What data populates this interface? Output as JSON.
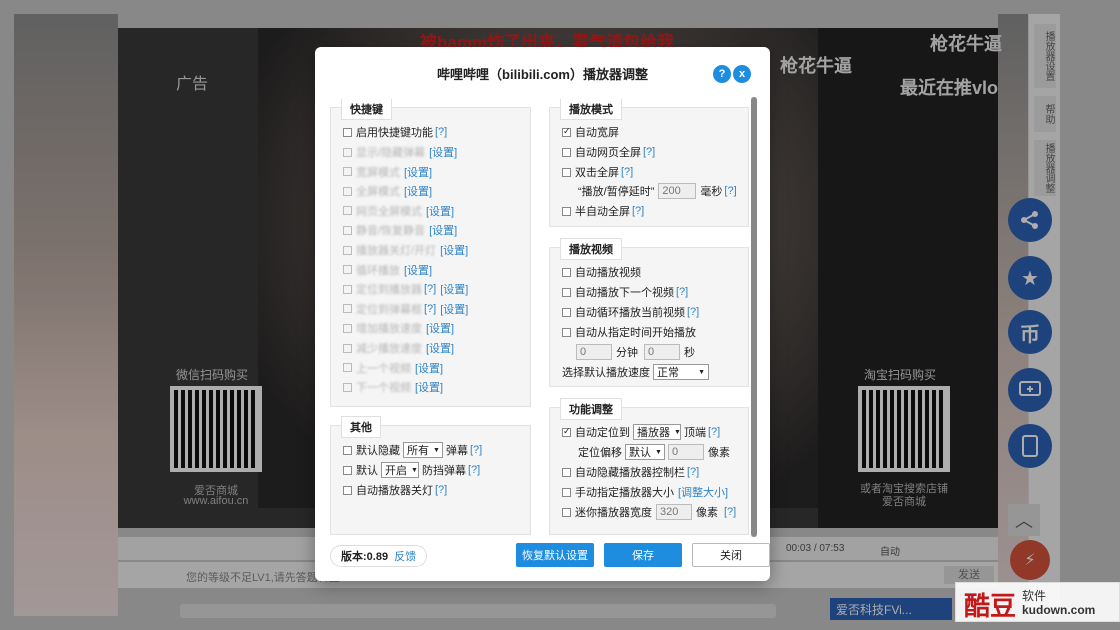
{
  "background": {
    "title_red": "被bamm炸了出来，看气请包给我",
    "ad_label": "广告",
    "overlay_text_1": "枪花牛逼",
    "overlay_text_2": "枪花牛逼",
    "overlay_text_3": "最近在推vlo",
    "qr_left_label": "微信扫码购买",
    "qr_left_sub1": "爱否商城",
    "qr_left_sub2": "www.aifou.cn",
    "qr_right_label": "淘宝扫码购买",
    "qr_right_sub1": "或者淘宝搜索店铺",
    "qr_right_sub2": "爱否商城",
    "time_current": "00:03",
    "time_sep": "/",
    "time_total": "07:53",
    "auto_label": "自动",
    "comment_placeholder": "您的等级不足LV1,请先答题转正",
    "send_label": "发送",
    "uploader": "爱否科技FVi...",
    "right_tabs": [
      "播放器设置",
      "帮助",
      "播放器调整"
    ],
    "fab_icons": [
      "share-icon",
      "star-icon",
      "coin-icon",
      "tv-icon",
      "phone-icon"
    ],
    "coin_glyph": "币"
  },
  "watermark": {
    "logo": "酷豆",
    "soft": "软件",
    "url": "kudown.com"
  },
  "dialog": {
    "title": "哔哩哔哩（bilibili.com）播放器调整",
    "help_btn": "?",
    "close_btn": "x",
    "hotkeys": {
      "legend": "快捷键",
      "enable_label": "启用快捷键功能",
      "enable_help": "[?]",
      "items": [
        {
          "label": "显示/隐藏弹幕",
          "link": "[设置]"
        },
        {
          "label": "宽屏模式",
          "link": "[设置]"
        },
        {
          "label": "全屏模式",
          "link": "[设置]"
        },
        {
          "label": "网页全屏模式",
          "link": "[设置]"
        },
        {
          "label": "静音/恢复静音",
          "link": "[设置]"
        },
        {
          "label": "播放器关灯/开灯",
          "link": "[设置]"
        },
        {
          "label": "循环播放",
          "link": "[设置]"
        },
        {
          "label": "定位到播放器",
          "help": "[?]",
          "link": "[设置]"
        },
        {
          "label": "定位到弹幕框",
          "help": "[?]",
          "link": "[设置]"
        },
        {
          "label": "增加播放速度",
          "link": "[设置]"
        },
        {
          "label": "减少播放速度",
          "link": "[设置]"
        },
        {
          "label": "上一个视频",
          "link": "[设置]"
        },
        {
          "label": "下一个视频",
          "link": "[设置]"
        }
      ]
    },
    "other": {
      "legend": "其他",
      "hide_prefix": "默认隐藏",
      "hide_select": "所有",
      "hide_suffix": "弹幕",
      "hide_help": "[?]",
      "block_prefix": "默认",
      "block_select": "开启",
      "block_suffix": "防挡弹幕",
      "block_help": "[?]",
      "lights_label": "自动播放器关灯",
      "lights_help": "[?]"
    },
    "play_mode": {
      "legend": "播放模式",
      "auto_wide": "自动宽屏",
      "auto_webfull": "自动网页全屏",
      "auto_webfull_help": "[?]",
      "dbl_full": "双击全屏",
      "dbl_full_help": "[?]",
      "delay_label": "“播放/暂停延时”",
      "delay_value": "200",
      "delay_unit": "毫秒",
      "delay_help": "[?]",
      "semi_full": "半自动全屏",
      "semi_full_help": "[?]"
    },
    "play_video": {
      "legend": "播放视频",
      "auto_play": "自动播放视频",
      "auto_next": "自动播放下一个视频",
      "auto_next_help": "[?]",
      "auto_loop": "自动循环播放当前视频",
      "auto_loop_help": "[?]",
      "auto_from": "自动从指定时间开始播放",
      "minutes_value": "0",
      "minutes_unit": "分钟",
      "seconds_value": "0",
      "seconds_unit": "秒",
      "speed_label": "选择默认播放速度",
      "speed_value": "正常"
    },
    "func": {
      "legend": "功能调整",
      "auto_locate": "自动定位到",
      "locate_select": "播放器",
      "locate_suffix": "顶端",
      "locate_help": "[?]",
      "offset_label": "定位偏移",
      "offset_select": "默认",
      "offset_value": "0",
      "offset_unit": "像素",
      "hide_ctrl": "自动隐藏播放器控制栏",
      "hide_ctrl_help": "[?]",
      "manual_size": "手动指定播放器大小",
      "manual_size_link": "[调整大小]",
      "mini_width": "迷你播放器宽度",
      "mini_value": "320",
      "mini_unit": "像素",
      "mini_help": "[?]"
    },
    "footer": {
      "version_label": "版本:0.89",
      "feedback": "反馈",
      "reset": "恢复默认设置",
      "save": "保存",
      "close": "关闭"
    }
  }
}
